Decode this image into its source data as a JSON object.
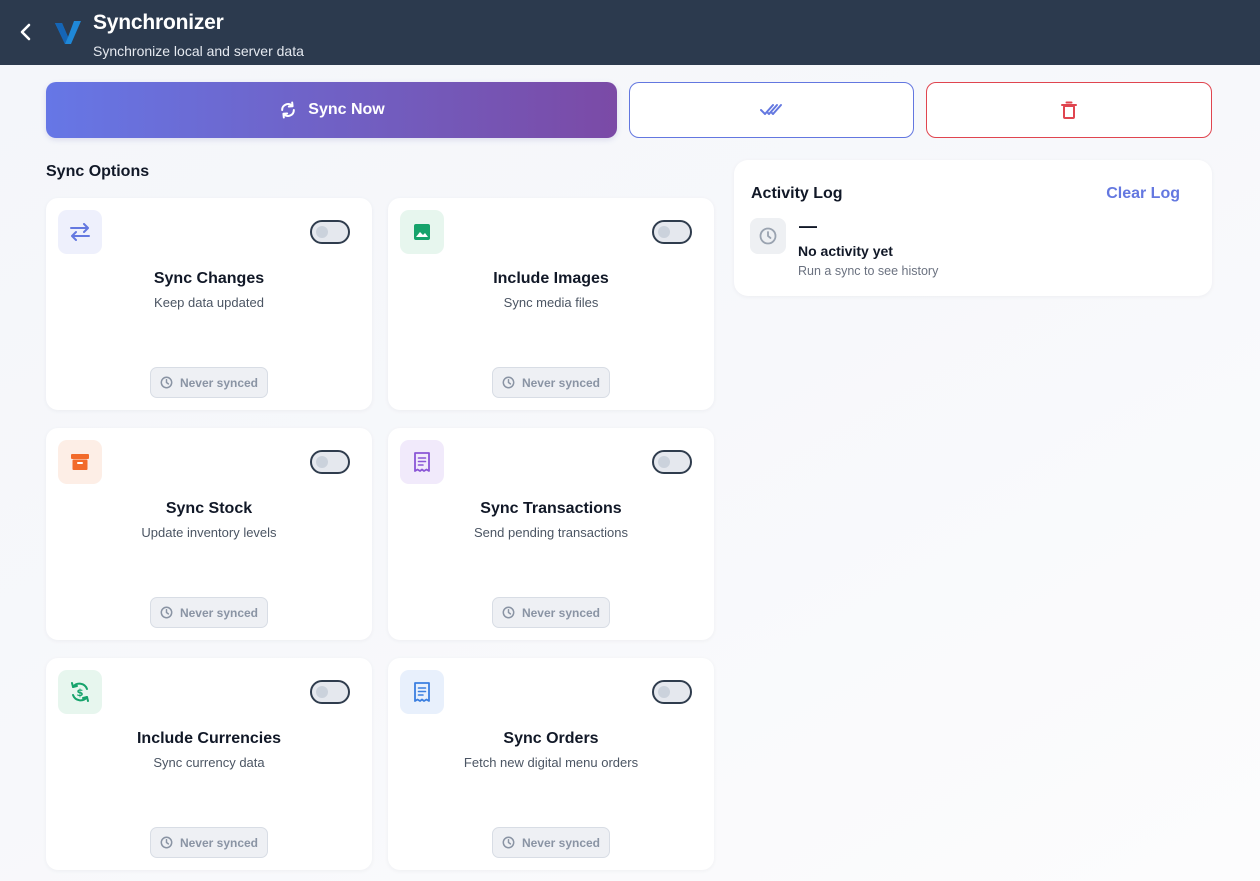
{
  "header": {
    "title": "Synchronizer",
    "subtitle": "Synchronize local and server data"
  },
  "actions": {
    "sync_now_label": "Sync Now"
  },
  "sync_options": {
    "title": "Sync Options",
    "items": [
      {
        "title": "Sync Changes",
        "description": "Keep data updated",
        "status": "Never synced",
        "enabled": false,
        "icon": "swap-arrows-icon",
        "icon_color": "#6478e0",
        "icon_bg": "#eef0fc"
      },
      {
        "title": "Include Images",
        "description": "Sync media files",
        "status": "Never synced",
        "enabled": false,
        "icon": "image-icon",
        "icon_color": "#16a36b",
        "icon_bg": "#e7f6ee"
      },
      {
        "title": "Sync Stock",
        "description": "Update inventory levels",
        "status": "Never synced",
        "enabled": false,
        "icon": "archive-box-icon",
        "icon_color": "#f26b2b",
        "icon_bg": "#fdeee6"
      },
      {
        "title": "Sync Transactions",
        "description": "Send pending transactions",
        "status": "Never synced",
        "enabled": false,
        "icon": "receipt-icon",
        "icon_color": "#8a56d6",
        "icon_bg": "#f1eafb"
      },
      {
        "title": "Include Currencies",
        "description": "Sync currency data",
        "status": "Never synced",
        "enabled": false,
        "icon": "currency-sync-icon",
        "icon_color": "#16a36b",
        "icon_bg": "#e7f6ee"
      },
      {
        "title": "Sync Orders",
        "description": "Fetch new digital menu orders",
        "status": "Never synced",
        "enabled": false,
        "icon": "order-receipt-icon",
        "icon_color": "#3b7fe0",
        "icon_bg": "#e8f0fc"
      }
    ]
  },
  "activity_log": {
    "title": "Activity Log",
    "clear_label": "Clear Log",
    "dash": "—",
    "empty_title": "No activity yet",
    "empty_subtitle": "Run a sync to see history"
  },
  "colors": {
    "header_bg": "#2c3a4e",
    "primary": "#6478e0",
    "danger": "#e0454f"
  }
}
